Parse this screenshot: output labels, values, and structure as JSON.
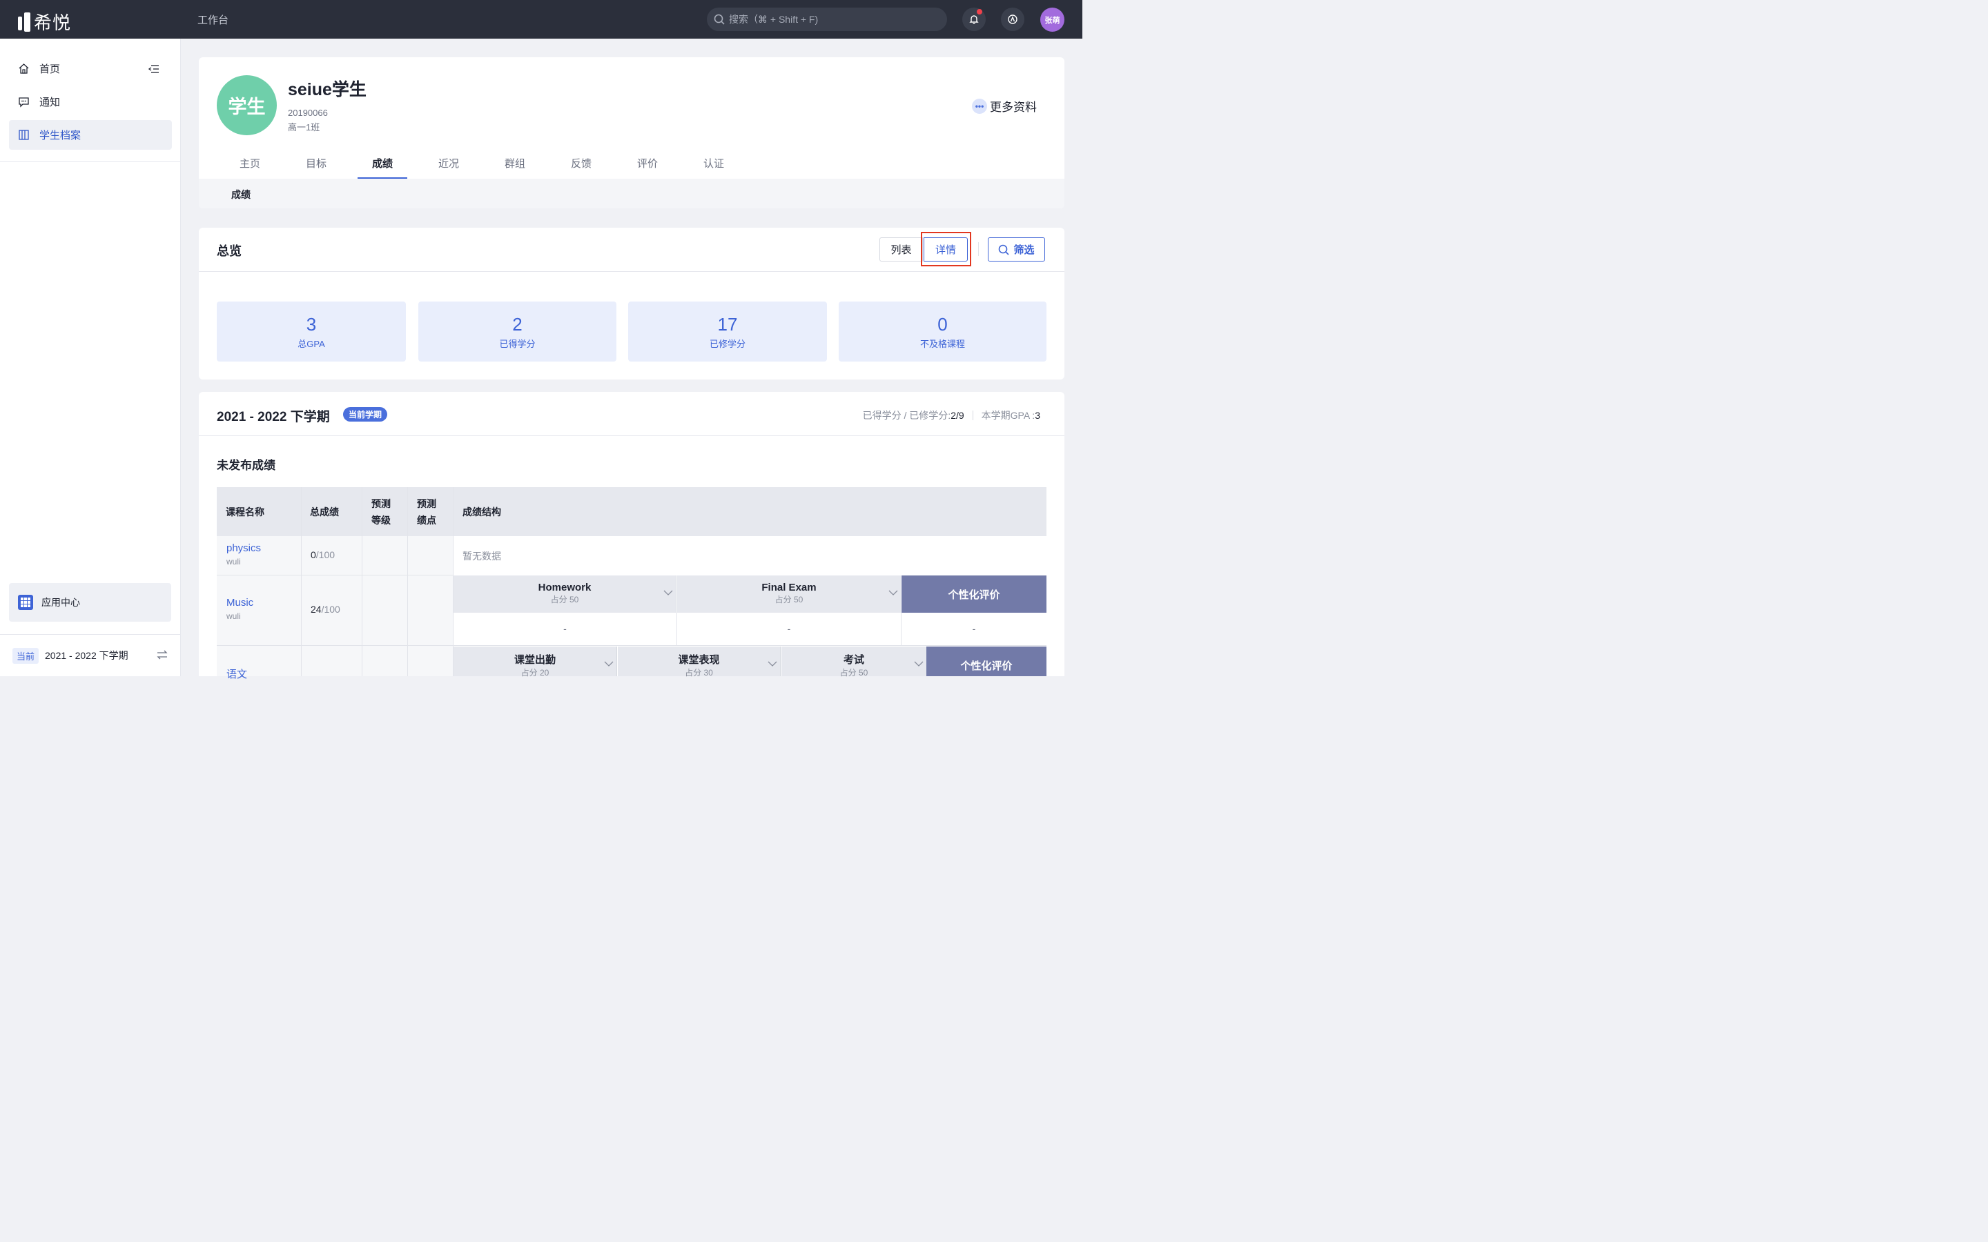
{
  "topbar": {
    "logo_text": "希悦",
    "workbench": "工作台",
    "search_placeholder": "搜索（⌘ + Shift + F)",
    "avatar_text": "张萌"
  },
  "sidebar": {
    "items": [
      {
        "label": "首页",
        "icon": "home-icon"
      },
      {
        "label": "通知",
        "icon": "message-icon"
      },
      {
        "label": "学生档案",
        "icon": "archive-icon",
        "active": true
      }
    ],
    "app_center": "应用中心",
    "term_tag": "当前",
    "term_text": "2021 - 2022 下学期"
  },
  "profile": {
    "avatar_text": "学生",
    "name": "seiue学生",
    "student_id": "20190066",
    "class_name": "高一1班",
    "more_info": "更多资料",
    "tabs": [
      "主页",
      "目标",
      "成绩",
      "近况",
      "群组",
      "反馈",
      "评价",
      "认证"
    ],
    "active_tab": "成绩",
    "subtab": "成绩"
  },
  "overview": {
    "title": "总览",
    "btn_list": "列表",
    "btn_detail": "详情",
    "btn_filter": "筛选",
    "stats": [
      {
        "value": "3",
        "label": "总GPA"
      },
      {
        "value": "2",
        "label": "已得学分"
      },
      {
        "value": "17",
        "label": "已修学分"
      },
      {
        "value": "0",
        "label": "不及格课程"
      }
    ]
  },
  "term": {
    "title": "2021 - 2022 下学期",
    "badge": "当前学期",
    "credits_label": "已得学分 / 已修学分:",
    "credits_value": "2/9",
    "gpa_label": "本学期GPA :",
    "gpa_value": "3",
    "section_title": "未发布成绩",
    "table": {
      "headers": {
        "course": "课程名称",
        "total": "总成绩",
        "pred_level": "预测等级",
        "pred_point": "预测绩点",
        "structure": "成绩结构"
      },
      "rows": [
        {
          "course": "physics",
          "teacher": "wuli",
          "score": "0",
          "max": "/100",
          "empty": "暂无数据"
        },
        {
          "course": "Music",
          "teacher": "wuli",
          "score": "24",
          "max": "/100",
          "items": [
            {
              "name": "Homework",
              "weight": "占分 50",
              "value": "-"
            },
            {
              "name": "Final Exam",
              "weight": "占分 50",
              "value": "-"
            }
          ],
          "personal": "个性化评价",
          "personal_value": "-"
        },
        {
          "course": "语文",
          "items": [
            {
              "name": "课堂出勤",
              "weight": "占分 20"
            },
            {
              "name": "课堂表现",
              "weight": "占分 30"
            },
            {
              "name": "考试",
              "weight": "占分 50"
            }
          ],
          "personal": "个性化评价"
        }
      ]
    }
  }
}
